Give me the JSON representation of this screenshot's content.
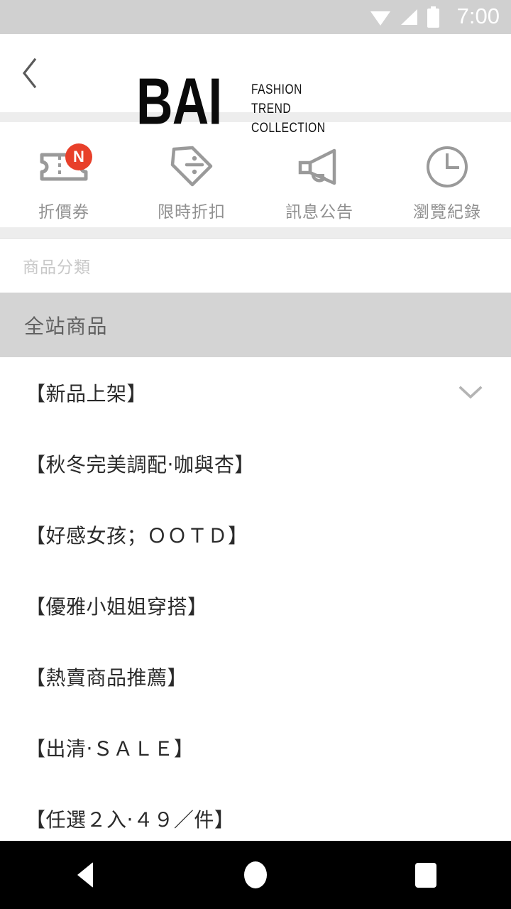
{
  "status_bar": {
    "time": "7:00",
    "icons": [
      "wifi-icon",
      "cellular-signal-icon",
      "battery-icon"
    ],
    "background_color": "#d0d0d0",
    "foreground_color": "#ffffff"
  },
  "app_bar": {
    "back_icon": "chevron-left-icon",
    "logo_main": "BAI",
    "logo_lines": [
      "FASHION",
      "TREND",
      "COLLECTION"
    ]
  },
  "quick_actions": [
    {
      "icon": "coupon-ticket-icon",
      "label": "折價券",
      "badge": "N",
      "badge_color": "#e8402a"
    },
    {
      "icon": "price-tag-discount-icon",
      "label": "限時折扣",
      "badge": ""
    },
    {
      "icon": "megaphone-icon",
      "label": "訊息公告",
      "badge": ""
    },
    {
      "icon": "clock-history-icon",
      "label": "瀏覽紀錄",
      "badge": ""
    }
  ],
  "category_section": {
    "header": "商品分類",
    "all_products_label": "全站商品",
    "all_products_bg": "#d4d4d4",
    "items": [
      {
        "label": "【新品上架】",
        "expandable": true,
        "chevron": "chevron-down-icon"
      },
      {
        "label": "【秋冬完美調配‧咖與杏】",
        "expandable": false
      },
      {
        "label": "【好感女孩；ＯＯＴＤ】",
        "expandable": false
      },
      {
        "label": "【優雅小姐姐穿搭】",
        "expandable": false
      },
      {
        "label": "【熱賣商品推薦】",
        "expandable": false
      },
      {
        "label": "【出清‧ＳＡＬＥ】",
        "expandable": false
      },
      {
        "label": "【任選２入‧４９／件】",
        "expandable": false
      }
    ]
  },
  "nav_bar": {
    "back": "triangle-back-icon",
    "home": "circle-home-icon",
    "recents": "square-recents-icon",
    "background_color": "#000000"
  }
}
